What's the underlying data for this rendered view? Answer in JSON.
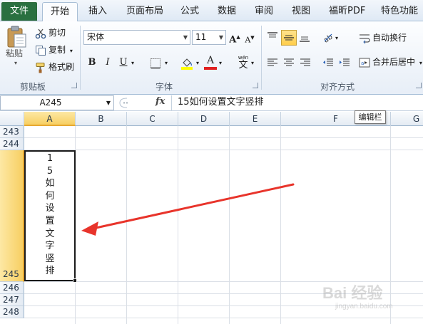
{
  "ribbon_tabs": [
    "文件",
    "开始",
    "插入",
    "页面布局",
    "公式",
    "数据",
    "审阅",
    "视图",
    "福昕PDF",
    "特色功能"
  ],
  "clipboard": {
    "paste": "粘贴",
    "cut": "剪切",
    "copy": "复制",
    "format_painter": "格式刷",
    "group": "剪贴板"
  },
  "font": {
    "name": "宋体",
    "size": "11",
    "bold": "B",
    "italic": "I",
    "underline": "U",
    "phonetic": "wén",
    "group": "字体"
  },
  "alignment": {
    "wrap_text": "自动换行",
    "merge_center": "合并后居中",
    "group": "对齐方式"
  },
  "formula_bar": {
    "name_box": "A245",
    "fx": "fx",
    "content": "15如何设置文字竖排",
    "tooltip": "编辑栏"
  },
  "columns": [
    "A",
    "B",
    "C",
    "D",
    "E",
    "F",
    "G"
  ],
  "rows": [
    "243",
    "244",
    "245",
    "246",
    "247",
    "248"
  ],
  "cell_a245_lines": [
    "1",
    "5",
    "如",
    "何",
    "设",
    "置",
    "文",
    "字",
    "竖",
    "排"
  ],
  "colors": {
    "file_tab": "#2a7040",
    "selection_header": "#f7cf63",
    "arrow": "#e8342b"
  },
  "watermark": {
    "text": "Bai 经验",
    "sub": "jingyan.baidu.com"
  }
}
